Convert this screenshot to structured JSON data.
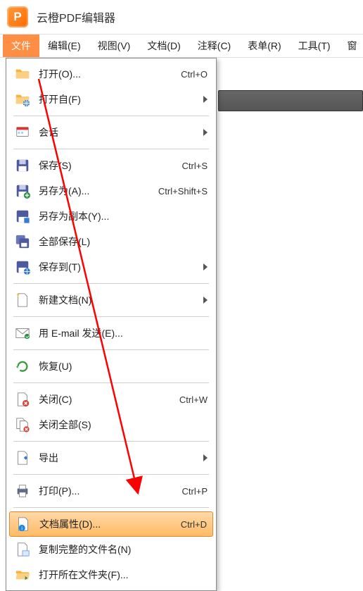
{
  "app": {
    "title": "云橙PDF编辑器",
    "icon_label": "P"
  },
  "menubar": {
    "items": [
      {
        "label": "文件",
        "active": true
      },
      {
        "label": "编辑(E)",
        "active": false
      },
      {
        "label": "视图(V)",
        "active": false
      },
      {
        "label": "文档(D)",
        "active": false
      },
      {
        "label": "注释(C)",
        "active": false
      },
      {
        "label": "表单(R)",
        "active": false
      },
      {
        "label": "工具(T)",
        "active": false
      },
      {
        "label": "窗",
        "active": false
      }
    ]
  },
  "dropdown": {
    "items": [
      {
        "icon": "folder",
        "label": "打开(O)...",
        "shortcut": "Ctrl+O",
        "submenu": false,
        "highlight": false
      },
      {
        "icon": "folder-globe",
        "label": "打开自(F)",
        "shortcut": "",
        "submenu": true,
        "highlight": false
      },
      {
        "sep": true
      },
      {
        "icon": "session",
        "label": "会话",
        "shortcut": "",
        "submenu": true,
        "highlight": false
      },
      {
        "sep": true
      },
      {
        "icon": "disk",
        "label": "保存(S)",
        "shortcut": "Ctrl+S",
        "submenu": false,
        "highlight": false
      },
      {
        "icon": "disk-as",
        "label": "另存为(A)...",
        "shortcut": "Ctrl+Shift+S",
        "submenu": false,
        "highlight": false
      },
      {
        "icon": "disk-copy",
        "label": "另存为副本(Y)...",
        "shortcut": "",
        "submenu": false,
        "highlight": false
      },
      {
        "icon": "disk-all",
        "label": "全部保存(L)",
        "shortcut": "",
        "submenu": false,
        "highlight": false
      },
      {
        "icon": "disk-globe",
        "label": "保存到(T)",
        "shortcut": "",
        "submenu": true,
        "highlight": false
      },
      {
        "sep": true
      },
      {
        "icon": "new-doc",
        "label": "新建文档(N)",
        "shortcut": "",
        "submenu": true,
        "highlight": false
      },
      {
        "sep": true
      },
      {
        "icon": "mail",
        "label": "用 E-mail 发送(E)...",
        "shortcut": "",
        "submenu": false,
        "highlight": false
      },
      {
        "sep": true
      },
      {
        "icon": "revert",
        "label": "恢复(U)",
        "shortcut": "",
        "submenu": false,
        "highlight": false
      },
      {
        "sep": true
      },
      {
        "icon": "close",
        "label": "关闭(C)",
        "shortcut": "Ctrl+W",
        "submenu": false,
        "highlight": false
      },
      {
        "icon": "close-all",
        "label": "关闭全部(S)",
        "shortcut": "",
        "submenu": false,
        "highlight": false
      },
      {
        "sep": true
      },
      {
        "icon": "export",
        "label": "导出",
        "shortcut": "",
        "submenu": true,
        "highlight": false
      },
      {
        "sep": true
      },
      {
        "icon": "print",
        "label": "打印(P)...",
        "shortcut": "Ctrl+P",
        "submenu": false,
        "highlight": false
      },
      {
        "sep": true
      },
      {
        "icon": "properties",
        "label": "文档属性(D)...",
        "shortcut": "Ctrl+D",
        "submenu": false,
        "highlight": true
      },
      {
        "icon": "copy-name",
        "label": "复制完整的文件名(N)",
        "shortcut": "",
        "submenu": false,
        "highlight": false
      },
      {
        "icon": "folder-open",
        "label": "打开所在文件夹(F)...",
        "shortcut": "",
        "submenu": false,
        "highlight": false
      }
    ]
  },
  "icons_svg": {
    "folder": "<svg viewBox='0 0 24 24' width='22' height='22'><path fill='#f9b23b' d='M2 5h7l2 3h11v11H2z'/><path fill='#fcd083' d='M2 9h20v10H2z'/></svg>",
    "folder-globe": "<svg viewBox='0 0 24 24' width='22' height='22'><path fill='#f9b23b' d='M2 5h7l2 3h11v11H2z'/><path fill='#fcd083' d='M2 9h20v10H2z'/><circle cx='18' cy='18' r='5' fill='#2e7bd6'/><path stroke='#fff' stroke-width='1' fill='none' d='M13 18h10M18 13v10M15 14a7 7 0 010 8M21 14a7 7 0 000 8'/></svg>",
    "session": "<svg viewBox='0 0 24 24' width='22' height='22'><rect x='3' y='4' width='18' height='14' rx='1' fill='#fff' stroke='#888'/><rect x='3' y='4' width='18' height='4' fill='#d33'/><rect x='5' y='11' width='3' height='3' fill='#9cf'/><rect x='10' y='11' width='3' height='3' fill='#9cf'/></svg>",
    "disk": "<svg viewBox='0 0 24 24' width='22' height='22'><rect x='3' y='3' width='18' height='18' rx='2' fill='#4e5a9e'/><rect x='7' y='3' width='10' height='7' fill='#c7cce8'/><rect x='6' y='13' width='12' height='8' fill='#fff'/></svg>",
    "disk-as": "<svg viewBox='0 0 24 24' width='22' height='22'><rect x='3' y='3' width='18' height='18' rx='2' fill='#4e5a9e'/><rect x='7' y='3' width='10' height='7' fill='#c7cce8'/><rect x='6' y='13' width='12' height='8' fill='#fff'/><circle cx='19' cy='19' r='5' fill='#2b9348'/><path d='M19 16v6M16 19h6' stroke='#fff' stroke-width='1.6'/></svg>",
    "disk-copy": "<svg viewBox='0 0 24 24' width='22' height='22'><rect x='3' y='3' width='18' height='18' rx='2' fill='#4e5a9e'/><rect x='6' y='13' width='12' height='8' fill='#fff'/><rect x='14' y='14' width='9' height='9' fill='#3a7bd5' stroke='#fff'/></svg>",
    "disk-all": "<svg viewBox='0 0 24 24' width='22' height='22'><rect x='2' y='2' width='14' height='14' rx='2' fill='#6b76b8'/><rect x='7' y='7' width='15' height='15' rx='2' fill='#4e5a9e'/><rect x='10' y='14' width='9' height='6' fill='#fff'/></svg>",
    "disk-globe": "<svg viewBox='0 0 24 24' width='22' height='22'><rect x='3' y='3' width='18' height='18' rx='2' fill='#4e5a9e'/><rect x='6' y='13' width='12' height='8' fill='#fff'/><circle cx='19' cy='19' r='5' fill='#2e7bd6'/><path stroke='#fff' fill='none' d='M14 19h10M19 14v10'/></svg>",
    "new-doc": "<svg viewBox='0 0 24 24' width='22' height='22'><path fill='#fff' stroke='#888' d='M5 2h10l4 4v16H5z'/><path fill='#f3c042' d='M3 3l2 4 2-4-2-1z'/></svg>",
    "mail": "<svg viewBox='0 0 24 24' width='22' height='22'><rect x='2' y='5' width='20' height='14' fill='#fff' stroke='#888'/><path d='M2 5l10 8 10-8' fill='none' stroke='#888'/><circle cx='19' cy='17' r='4' fill='#2b9348'/><path d='M17 17l2 2 3-3' stroke='#fff' fill='none'/></svg>",
    "revert": "<svg viewBox='0 0 24 24' width='22' height='22'><path fill='none' stroke='#3a9b3a' stroke-width='2.5' d='M5 12a7 7 0 1 1 3 6'/><path fill='#3a9b3a' d='M5 11l-3 2 3 2z'/></svg>",
    "close": "<svg viewBox='0 0 24 24' width='22' height='22'><path fill='#fff' stroke='#888' d='M5 2h10l4 4v16H5z'/><circle cx='17' cy='18' r='5' fill='#d9443a'/><path d='M15 16l4 4M19 16l-4 4' stroke='#fff' stroke-width='1.6'/></svg>",
    "close-all": "<svg viewBox='0 0 24 24' width='22' height='22'><path fill='#fff' stroke='#888' d='M3 2h9l3 3v13H3z'/><path fill='#fff' stroke='#888' d='M8 6h9l3 3v13H8z'/><circle cx='18' cy='19' r='4.5' fill='#d9443a'/><path d='M16 17l4 4M20 17l-4 4' stroke='#fff' stroke-width='1.4'/></svg>",
    "export": "<svg viewBox='0 0 24 24' width='22' height='22'><path fill='#fff' stroke='#888' d='M5 2h10l4 4v16H5z'/><path fill='#2e7bd6' d='M14 12h6l-3-3zM14 12h6l-3 3z'/></svg>",
    "print": "<svg viewBox='0 0 24 24' width='22' height='22'><rect x='4' y='8' width='16' height='9' rx='1' fill='#5b6b88'/><rect x='7' y='3' width='10' height='6' fill='#fff' stroke='#888'/><rect x='7' y='14' width='10' height='7' fill='#fff' stroke='#888'/></svg>",
    "properties": "<svg viewBox='0 0 24 24' width='22' height='22'><path fill='#fff' stroke='#888' d='M5 2h10l4 4v16H5z'/><circle cx='10' cy='18' r='5' fill='#1e88e5'/><text x='10' y='21' font-size='8' fill='#fff' text-anchor='middle' font-family='Arial'>i</text></svg>",
    "copy-name": "<svg viewBox='0 0 24 24' width='22' height='22'><path fill='#fff' stroke='#888' d='M5 2h10l4 4v16H5z'/><rect x='12' y='14' width='10' height='8' fill='#dce9ff' stroke='#6fa8e8'/></svg>",
    "folder-open": "<svg viewBox='0 0 24 24' width='22' height='22'><path fill='#f9b23b' d='M2 6h7l2 2h11v2H2z'/><path fill='#fcd083' d='M3 10h20l-2 9H2z'/><path fill='#2b9348' d='M16 14l4 3-4 3z'/></svg>"
  }
}
